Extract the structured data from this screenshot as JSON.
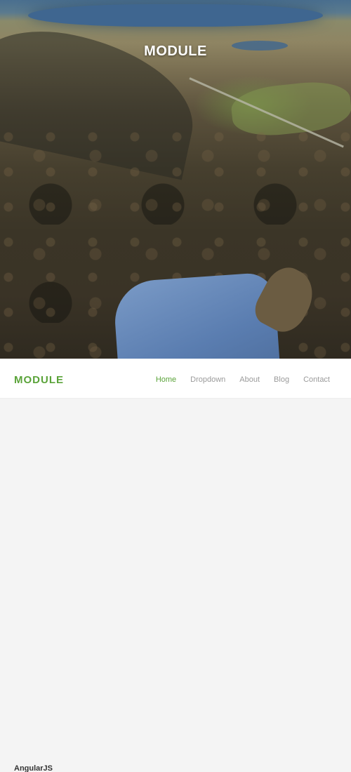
{
  "hero": {
    "title": "MODULE"
  },
  "navbar": {
    "brand": "MODULE",
    "items": [
      {
        "label": "Home",
        "active": true
      },
      {
        "label": "Dropdown",
        "active": false
      },
      {
        "label": "About",
        "active": false
      },
      {
        "label": "Blog",
        "active": false
      },
      {
        "label": "Contact",
        "active": false
      }
    ]
  },
  "content": {
    "section_label": "AngularJS"
  },
  "colors": {
    "accent": "#5aa339",
    "nav_text": "#9a9a9a",
    "background": "#f4f4f4"
  }
}
